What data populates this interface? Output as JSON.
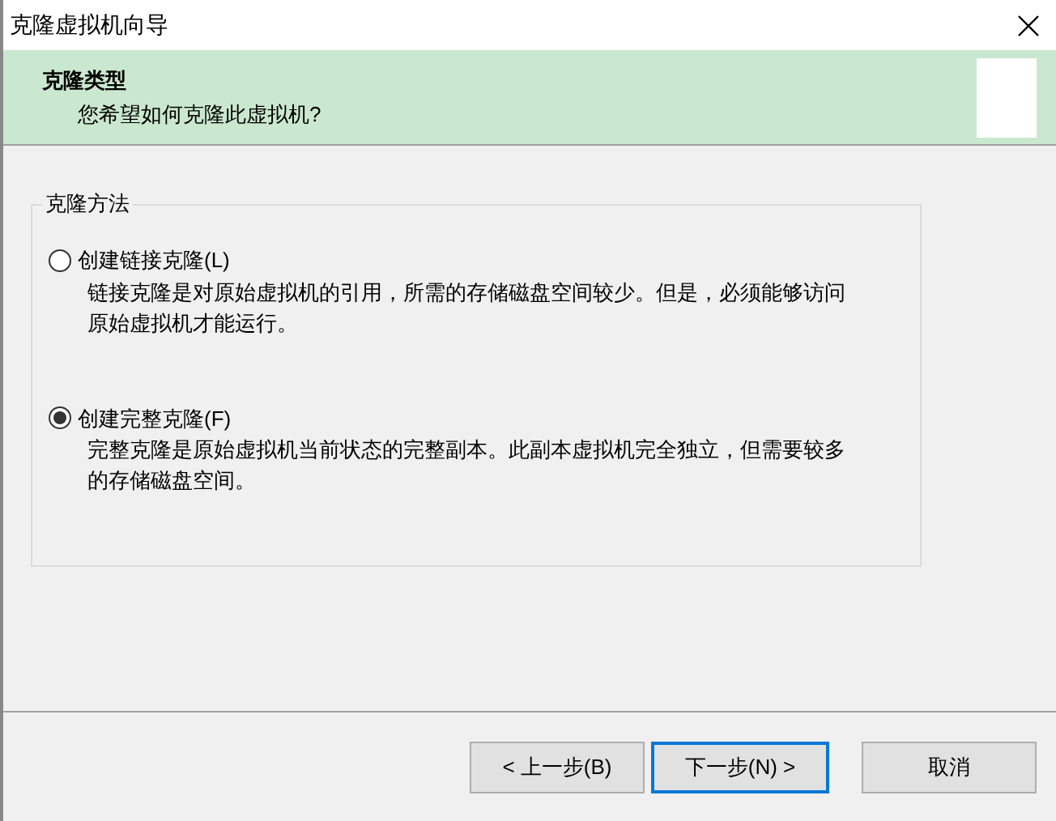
{
  "window": {
    "title": "克隆虚拟机向导"
  },
  "header": {
    "title": "克隆类型",
    "subtitle": "您希望如何克隆此虚拟机?"
  },
  "group": {
    "label": "克隆方法",
    "options": [
      {
        "label": "创建链接克隆(L)",
        "description": "链接克隆是对原始虚拟机的引用，所需的存储磁盘空间较少。但是，必须能够访问原始虚拟机才能运行。",
        "selected": false
      },
      {
        "label": "创建完整克隆(F)",
        "description": "完整克隆是原始虚拟机当前状态的完整副本。此副本虚拟机完全独立，但需要较多的存储磁盘空间。",
        "selected": true
      }
    ]
  },
  "buttons": [
    {
      "label": "< 上一步(B)",
      "default": false
    },
    {
      "label": "下一步(N) >",
      "default": true
    },
    {
      "label": "取消",
      "default": false
    }
  ]
}
